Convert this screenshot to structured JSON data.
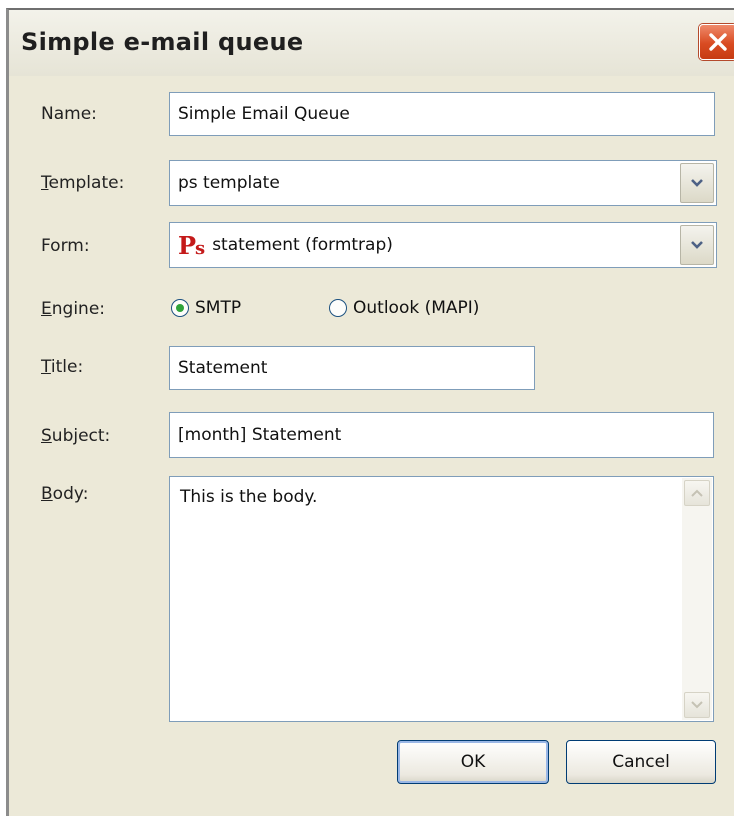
{
  "window": {
    "title": "Simple e-mail queue"
  },
  "labels": {
    "name": "Name:",
    "template_mnemonic": "T",
    "template_rest": "emplate:",
    "form": "Form:",
    "engine_mnemonic": "E",
    "engine_rest": "ngine:",
    "title_mnemonic": "T",
    "title_rest": "itle:",
    "subject_mnemonic": "S",
    "subject_rest": "ubject:",
    "body_mnemonic": "B",
    "body_rest": "ody:"
  },
  "fields": {
    "name_value": "Simple Email Queue",
    "template_value": "ps template",
    "form_logo": "Ps",
    "form_value": "statement (formtrap)",
    "title_value": "Statement",
    "subject_value": "[month] Statement",
    "body_value": "This is the body."
  },
  "engine": {
    "options": [
      "SMTP",
      "Outlook (MAPI)"
    ],
    "selected": "SMTP"
  },
  "buttons": {
    "ok": "OK",
    "cancel": "Cancel"
  },
  "colors": {
    "dialog_bg": "#ece9d8",
    "field_border": "#7f9db9",
    "close_button": "#d94b22",
    "radio_selected": "#2fa33a",
    "logo_red": "#c41a1a"
  }
}
